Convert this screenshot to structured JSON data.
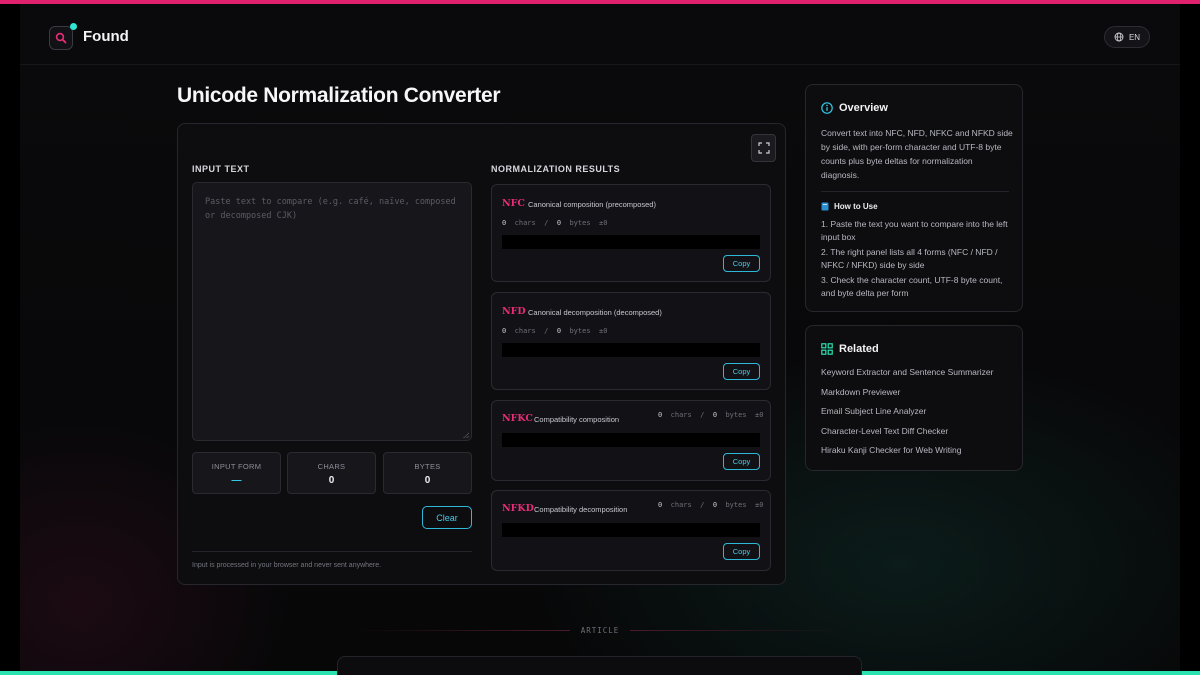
{
  "app": {
    "name": "Found",
    "language": "EN"
  },
  "colors": {
    "accent_pink": "#ea2c78",
    "accent_cyan": "#33c8e8",
    "accent_green": "#2be3b0"
  },
  "page": {
    "title": "Unicode Normalization Converter"
  },
  "input": {
    "section_label": "INPUT TEXT",
    "placeholder": "Paste text to compare (e.g. café, naïve, composed or decomposed CJK)",
    "value": "",
    "stats": [
      {
        "label": "INPUT FORM",
        "value": "—"
      },
      {
        "label": "CHARS",
        "value": "0"
      },
      {
        "label": "BYTES",
        "value": "0"
      }
    ],
    "clear_label": "Clear",
    "privacy_note": "Input is processed in your browser and never sent anywhere."
  },
  "results": {
    "section_label": "NORMALIZATION RESULTS",
    "items": [
      {
        "form": "NFC",
        "description": "Canonical composition (precomposed)",
        "chars": "0",
        "chars_label": "chars",
        "bytes": "0",
        "bytes_label": "bytes",
        "delta": "±0",
        "output": "",
        "copy_label": "Copy"
      },
      {
        "form": "NFD",
        "description": "Canonical decomposition (decomposed)",
        "chars": "0",
        "chars_label": "chars",
        "bytes": "0",
        "bytes_label": "bytes",
        "delta": "±0",
        "output": "",
        "copy_label": "Copy"
      },
      {
        "form": "NFKC",
        "description": "Compatibility composition",
        "chars": "0",
        "chars_label": "chars",
        "bytes": "0",
        "bytes_label": "bytes",
        "delta": "±0",
        "output": "",
        "copy_label": "Copy"
      },
      {
        "form": "NFKD",
        "description": "Compatibility decomposition",
        "chars": "0",
        "chars_label": "chars",
        "bytes": "0",
        "bytes_label": "bytes",
        "delta": "±0",
        "output": "",
        "copy_label": "Copy"
      }
    ]
  },
  "overview": {
    "title": "Overview",
    "icon": "info-icon",
    "text": "Convert text into NFC, NFD, NFKC and NFKD side by side, with per-form character and UTF-8 byte counts plus byte deltas for normalization diagnosis.",
    "howto_title": "How to Use",
    "howto_icon": "book-icon",
    "steps": [
      "1. Paste the text you want to compare into the left input box",
      "2. The right panel lists all 4 forms (NFC / NFD / NFKC / NFKD) side by side",
      "3. Check the character count, UTF-8 byte count, and byte delta per form"
    ]
  },
  "related": {
    "title": "Related",
    "icon": "grid-icon",
    "items": [
      "Keyword Extractor and Sentence Summarizer",
      "Markdown Previewer",
      "Email Subject Line Analyzer",
      "Character-Level Text Diff Checker",
      "Hiraku Kanji Checker for Web Writing"
    ]
  },
  "article": {
    "label": "ARTICLE"
  }
}
